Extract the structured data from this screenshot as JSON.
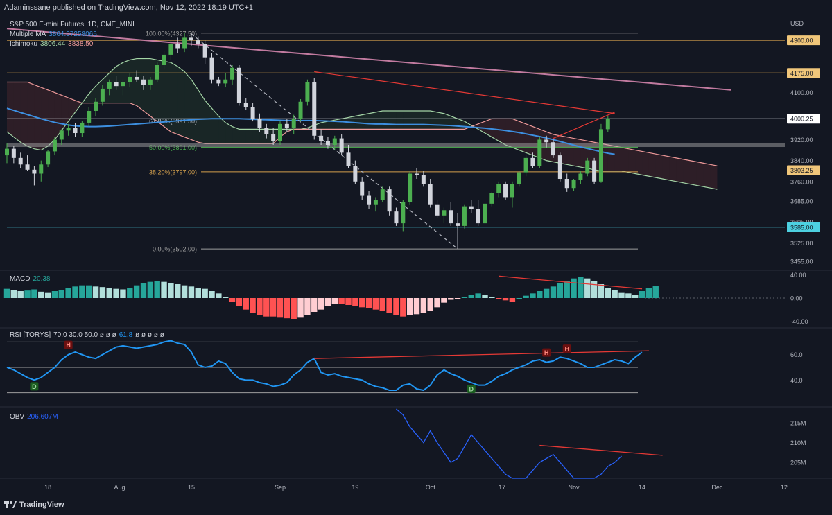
{
  "header": {
    "publish_line": "Adaminssane published on TradingView.com, Nov 12, 2022 18:19 UTC+1",
    "brand": "TradingView"
  },
  "legend": {
    "symbol": "S&P 500 E-mini Futures, 1D, CME_MINI",
    "ma_label": "Multiple MA",
    "ma_value": "3864.07258065",
    "ichimoku_label": "Ichimoku",
    "ichimoku_v1": "3806.44",
    "ichimoku_v2": "3838.50",
    "macd_label": "MACD",
    "macd_value": "20.38",
    "rsi_label": "RSI [TORYS]",
    "rsi_params": "70.0  30.0  50.0  ø  ø  ø",
    "rsi_value": "61.8",
    "rsi_tail": "ø  ø  ø  ø  ø",
    "obv_label": "OBV",
    "obv_value": "206.607M"
  },
  "colors": {
    "background": "#131722",
    "up": "#4caf50",
    "down": "#d1d4dc",
    "ma": "#3d8fe0",
    "cloud_green": "#a5d6a7",
    "cloud_red": "#ef9a9a",
    "fib": "#d4a04d",
    "trend_pink": "#c27ba0",
    "trend_red": "#e53935",
    "macd_teal": "#26a69a",
    "macd_light_teal": "#b2dfdb",
    "macd_red": "#ff5252",
    "macd_light_red": "#ffcdd2",
    "rsi": "#2196f3",
    "obv": "#2962ff",
    "support": "#4dd0e1"
  },
  "chart_data": [
    {
      "type": "candlestick",
      "title": "S&P 500 E-mini Futures, 1D, CME_MINI",
      "y_unit": "USD",
      "ylim": [
        3420,
        4380
      ],
      "x_ticks": [
        "18",
        "Aug",
        "15",
        "Sep",
        "19",
        "Oct",
        "17",
        "Nov",
        "14",
        "Dec",
        "12"
      ],
      "price_ticks": [
        4300.0,
        4175.0,
        4100.0,
        4000.25,
        3920.0,
        3840.0,
        3803.25,
        3760.0,
        3685.0,
        3605.0,
        3585.0,
        3525.0,
        3455.0
      ],
      "highlighted_ticks": [
        {
          "label": "4300.00",
          "style": "gold"
        },
        {
          "label": "4175.00",
          "style": "gold"
        },
        {
          "label": "4000.25",
          "style": "white"
        },
        {
          "label": "3803.25",
          "style": "gold"
        },
        {
          "label": "3585.00",
          "style": "cyan"
        }
      ],
      "tick_labels": [
        "4300.00",
        "4175.00",
        "4100.00",
        "4000.25",
        "3920.00",
        "3840.00",
        "3803.25",
        "3760.00",
        "3685.00",
        "3605.00",
        "3585.00",
        "3525.00",
        "3455.00"
      ],
      "fib_levels": [
        {
          "label": "100.00%(4327.50)",
          "price": 4327.5
        },
        {
          "label": "61.80%(3991.50)",
          "price": 3991.5
        },
        {
          "label": "50.00%(3891.00)",
          "price": 3891.0
        },
        {
          "label": "38.20%(3797.00)",
          "price": 3797.0
        },
        {
          "label": "0.00%(3502.00)",
          "price": 3502.0
        }
      ],
      "horizontal_levels": [
        4300.0,
        4175.0,
        4000.25,
        3585.0
      ],
      "candles": [
        [
          3860,
          3905,
          3830,
          3885
        ],
        [
          3885,
          3895,
          3830,
          3850
        ],
        [
          3850,
          3870,
          3810,
          3825
        ],
        [
          3825,
          3860,
          3800,
          3805
        ],
        [
          3805,
          3820,
          3745,
          3790
        ],
        [
          3790,
          3840,
          3760,
          3825
        ],
        [
          3825,
          3880,
          3815,
          3875
        ],
        [
          3875,
          3930,
          3860,
          3920
        ],
        [
          3920,
          3960,
          3900,
          3955
        ],
        [
          3955,
          3980,
          3935,
          3965
        ],
        [
          3965,
          3985,
          3930,
          3945
        ],
        [
          3945,
          3990,
          3930,
          3985
        ],
        [
          3985,
          4045,
          3970,
          4030
        ],
        [
          4030,
          4080,
          4010,
          4065
        ],
        [
          4065,
          4130,
          4050,
          4115
        ],
        [
          4115,
          4150,
          4090,
          4140
        ],
        [
          4140,
          4165,
          4110,
          4125
        ],
        [
          4125,
          4150,
          4090,
          4140
        ],
        [
          4140,
          4175,
          4120,
          4160
        ],
        [
          4160,
          4185,
          4140,
          4150
        ],
        [
          4150,
          4165,
          4110,
          4130
        ],
        [
          4130,
          4160,
          4110,
          4150
        ],
        [
          4150,
          4215,
          4140,
          4205
        ],
        [
          4205,
          4260,
          4190,
          4245
        ],
        [
          4245,
          4300,
          4225,
          4285
        ],
        [
          4285,
          4310,
          4250,
          4270
        ],
        [
          4270,
          4327,
          4255,
          4310
        ],
        [
          4310,
          4325,
          4280,
          4300
        ],
        [
          4300,
          4315,
          4270,
          4285
        ],
        [
          4285,
          4300,
          4210,
          4235
        ],
        [
          4235,
          4250,
          4135,
          4150
        ],
        [
          4150,
          4160,
          4125,
          4135
        ],
        [
          4135,
          4175,
          4120,
          4150
        ],
        [
          4150,
          4205,
          4130,
          4195
        ],
        [
          4195,
          4205,
          4050,
          4060
        ],
        [
          4060,
          4080,
          4035,
          4045
        ],
        [
          4045,
          4060,
          3990,
          4000
        ],
        [
          4000,
          4020,
          3950,
          3965
        ],
        [
          3965,
          3980,
          3925,
          3940
        ],
        [
          3940,
          3965,
          3900,
          3915
        ],
        [
          3915,
          3990,
          3900,
          3980
        ],
        [
          3980,
          4000,
          3950,
          3965
        ],
        [
          3965,
          4015,
          3940,
          4000
        ],
        [
          4000,
          4075,
          3990,
          4065
        ],
        [
          4065,
          4150,
          4050,
          4140
        ],
        [
          4140,
          4155,
          3920,
          3935
        ],
        [
          3935,
          3960,
          3900,
          3915
        ],
        [
          3915,
          3930,
          3885,
          3900
        ],
        [
          3900,
          3935,
          3880,
          3925
        ],
        [
          3925,
          3940,
          3860,
          3870
        ],
        [
          3870,
          3900,
          3810,
          3820
        ],
        [
          3820,
          3840,
          3750,
          3760
        ],
        [
          3760,
          3775,
          3690,
          3705
        ],
        [
          3705,
          3725,
          3655,
          3670
        ],
        [
          3670,
          3700,
          3645,
          3690
        ],
        [
          3690,
          3740,
          3680,
          3730
        ],
        [
          3730,
          3740,
          3630,
          3645
        ],
        [
          3645,
          3660,
          3590,
          3600
        ],
        [
          3600,
          3690,
          3570,
          3680
        ],
        [
          3680,
          3800,
          3670,
          3790
        ],
        [
          3790,
          3810,
          3770,
          3785
        ],
        [
          3785,
          3800,
          3740,
          3750
        ],
        [
          3750,
          3770,
          3660,
          3670
        ],
        [
          3670,
          3690,
          3620,
          3630
        ],
        [
          3630,
          3660,
          3600,
          3650
        ],
        [
          3650,
          3680,
          3590,
          3600
        ],
        [
          3600,
          3640,
          3502,
          3590
        ],
        [
          3590,
          3670,
          3580,
          3665
        ],
        [
          3665,
          3690,
          3640,
          3655
        ],
        [
          3655,
          3690,
          3590,
          3600
        ],
        [
          3600,
          3680,
          3590,
          3675
        ],
        [
          3675,
          3720,
          3665,
          3715
        ],
        [
          3715,
          3760,
          3700,
          3750
        ],
        [
          3750,
          3760,
          3690,
          3700
        ],
        [
          3700,
          3760,
          3660,
          3750
        ],
        [
          3750,
          3800,
          3740,
          3795
        ],
        [
          3795,
          3860,
          3780,
          3850
        ],
        [
          3850,
          3870,
          3810,
          3820
        ],
        [
          3820,
          3930,
          3810,
          3920
        ],
        [
          3920,
          3935,
          3890,
          3910
        ],
        [
          3910,
          3920,
          3850,
          3860
        ],
        [
          3860,
          3870,
          3760,
          3770
        ],
        [
          3770,
          3790,
          3720,
          3735
        ],
        [
          3735,
          3770,
          3725,
          3765
        ],
        [
          3765,
          3800,
          3750,
          3790
        ],
        [
          3790,
          3850,
          3780,
          3840
        ],
        [
          3840,
          3850,
          3750,
          3760
        ],
        [
          3760,
          3980,
          3755,
          3960
        ],
        [
          3960,
          4010,
          3950,
          4000.25
        ]
      ],
      "moving_average": [
        4040,
        4032,
        4024,
        4016,
        4008,
        4000,
        3993,
        3986,
        3981,
        3976,
        3973,
        3971,
        3970,
        3970,
        3971,
        3972,
        3974,
        3976,
        3978,
        3980,
        3982,
        3984,
        3986,
        3988,
        3990,
        3992,
        3994,
        3996,
        3998,
        3999,
        4000,
        4000,
        4000,
        4000,
        4000,
        3999,
        3998,
        3997,
        3996,
        3995,
        3994,
        3993,
        3993,
        3993,
        3993,
        3993,
        3992,
        3991,
        3990,
        3989,
        3987,
        3985,
        3983,
        3981,
        3980,
        3980,
        3979,
        3978,
        3978,
        3978,
        3978,
        3978,
        3977,
        3976,
        3975,
        3974,
        3972,
        3970,
        3968,
        3966,
        3964,
        3961,
        3958,
        3955,
        3951,
        3947,
        3942,
        3937,
        3932,
        3926,
        3920,
        3913,
        3906,
        3899,
        3892,
        3886,
        3880,
        3874,
        3868,
        3864
      ],
      "ichimoku_span_a": [
        3950,
        3930,
        3910,
        3895,
        3885,
        3880,
        3895,
        3920,
        3955,
        3990,
        4025,
        4060,
        4095,
        4125,
        4150,
        4175,
        4200,
        4215,
        4225,
        4230,
        4230,
        4230,
        4225,
        4220,
        4215,
        4200,
        4180,
        4150,
        4110,
        4070,
        4040,
        4010,
        3985,
        3970,
        3960,
        3960,
        3960,
        3960,
        3960,
        3960,
        3960,
        3960,
        3960,
        3960,
        3965,
        3975,
        3985,
        3990,
        3995,
        4000,
        4005,
        4010,
        4015,
        4020,
        4025,
        4030,
        4030,
        4030,
        4030,
        4030,
        4030,
        4030,
        4030,
        4025,
        4020,
        4010,
        4000,
        3990,
        3975,
        3960,
        3945,
        3930,
        3915,
        3900,
        3890,
        3880,
        3870,
        3860,
        3850,
        3840,
        3835,
        3830,
        3825,
        3820,
        3815,
        3810,
        3805,
        3800,
        3800,
        3800,
        3800,
        3795,
        3790,
        3785,
        3780,
        3775,
        3770,
        3765,
        3760,
        3755,
        3750,
        3745,
        3740,
        3735,
        3730
      ],
      "ichimoku_span_b": [
        4140,
        4140,
        4140,
        4140,
        4130,
        4120,
        4110,
        4100,
        4090,
        4080,
        4070,
        4060,
        4060,
        4060,
        4060,
        4060,
        4060,
        4060,
        4060,
        4050,
        4030,
        4010,
        3990,
        3970,
        3950,
        3940,
        3930,
        3920,
        3910,
        3905,
        3905,
        3905,
        3905,
        3905,
        3905,
        3905,
        3905,
        3905,
        3905,
        3905,
        3930,
        3950,
        3960,
        3960,
        3960,
        3960,
        3960,
        3960,
        3960,
        3960,
        3960,
        3960,
        3960,
        3960,
        3960,
        3960,
        3960,
        3960,
        3960,
        3960,
        3960,
        3960,
        3960,
        3960,
        3960,
        3960,
        3960,
        3960,
        3970,
        3980,
        3990,
        4000,
        4000,
        4000,
        4000,
        3990,
        3980,
        3970,
        3960,
        3950,
        3940,
        3935,
        3930,
        3925,
        3920,
        3915,
        3910,
        3905,
        3900,
        3895,
        3890,
        3885,
        3880,
        3875,
        3870,
        3865,
        3860,
        3855,
        3850,
        3845,
        3840,
        3835,
        3830,
        3825,
        3820
      ],
      "trend_lines": [
        {
          "name": "pink-descending",
          "from": [
            0,
            4345
          ],
          "to": [
            106,
            4110
          ]
        },
        {
          "name": "red-upper",
          "from": [
            45,
            4180
          ],
          "to": [
            89,
            4020
          ]
        },
        {
          "name": "red-rising",
          "from": [
            80,
            3925
          ],
          "to": [
            89,
            4025
          ]
        },
        {
          "name": "dashed-descent",
          "from": [
            27,
            4325
          ],
          "to": [
            66,
            3502
          ]
        }
      ]
    },
    {
      "type": "bar",
      "title": "MACD",
      "value": 20.38,
      "tick_labels": [
        "40.00",
        "0.00",
        "-40.00"
      ],
      "ylim": [
        -48,
        48
      ],
      "values": [
        16,
        14,
        12,
        13,
        15,
        11,
        10,
        12,
        14,
        18,
        20,
        22,
        22,
        20,
        19,
        18,
        16,
        15,
        17,
        22,
        26,
        28,
        29,
        28,
        26,
        24,
        22,
        20,
        18,
        16,
        12,
        8,
        2,
        -6,
        -14,
        -20,
        -26,
        -30,
        -32,
        -32,
        -34,
        -35,
        -36,
        -34,
        -30,
        -24,
        -20,
        -14,
        -10,
        -10,
        -12,
        -14,
        -16,
        -18,
        -20,
        -22,
        -26,
        -30,
        -32,
        -30,
        -28,
        -26,
        -22,
        -16,
        -8,
        -3,
        -1,
        2,
        6,
        8,
        6,
        2,
        -2,
        -4,
        -6,
        0,
        4,
        8,
        12,
        16,
        20,
        26,
        30,
        34,
        36,
        34,
        30,
        24,
        18,
        14,
        10,
        8,
        6,
        12,
        18,
        20.38
      ],
      "divergence_line": {
        "from": [
          72,
          38
        ],
        "to": [
          93,
          16
        ]
      }
    },
    {
      "type": "line",
      "title": "RSI [TORYS]",
      "value": 61.8,
      "tick_labels": [
        "60.0",
        "40.0"
      ],
      "ylim": [
        20,
        80
      ],
      "levels": [
        70,
        50,
        30
      ],
      "values": [
        50,
        48,
        45,
        42,
        40,
        42,
        46,
        50,
        56,
        60,
        62,
        60,
        58,
        57,
        60,
        63,
        66,
        67,
        66,
        65,
        66,
        67,
        68,
        70,
        71,
        69,
        68,
        62,
        52,
        50,
        51,
        55,
        53,
        46,
        41,
        40,
        40,
        38,
        37,
        35,
        36,
        38,
        44,
        48,
        54,
        57,
        46,
        44,
        45,
        43,
        42,
        41,
        40,
        37,
        35,
        34,
        32,
        32,
        36,
        37,
        33,
        32,
        36,
        44,
        48,
        45,
        43,
        40,
        38,
        36,
        36,
        39,
        43,
        45,
        48,
        50,
        52,
        55,
        56,
        54,
        55,
        58,
        57,
        55,
        53,
        50,
        50,
        52,
        54,
        56,
        55,
        53,
        58,
        61.8
      ],
      "markers": [
        {
          "label": "D",
          "index": 4
        },
        {
          "label": "H",
          "index": 9
        },
        {
          "label": "D",
          "index": 68
        },
        {
          "label": "H",
          "index": 79
        },
        {
          "label": "H",
          "index": 82
        }
      ],
      "divergence_line": {
        "from": [
          45,
          57
        ],
        "to": [
          94,
          63
        ]
      }
    },
    {
      "type": "line",
      "title": "OBV",
      "value_label": "206.607M",
      "tick_labels": [
        "215M",
        "210M",
        "205M"
      ],
      "ylim": [
        201,
        218.5
      ],
      "x_start_index": 57,
      "values": [
        220,
        217,
        214,
        212,
        210,
        213,
        210,
        207.5,
        205,
        206,
        209,
        212,
        210,
        208,
        206,
        204,
        202,
        200.5,
        199,
        201,
        203,
        205,
        206,
        207,
        205,
        203,
        201,
        200,
        199,
        200,
        202,
        204,
        205,
        206.607
      ],
      "divergence_line": {
        "from": [
          78,
          209.3
        ],
        "to": [
          96,
          206.8
        ]
      }
    }
  ]
}
